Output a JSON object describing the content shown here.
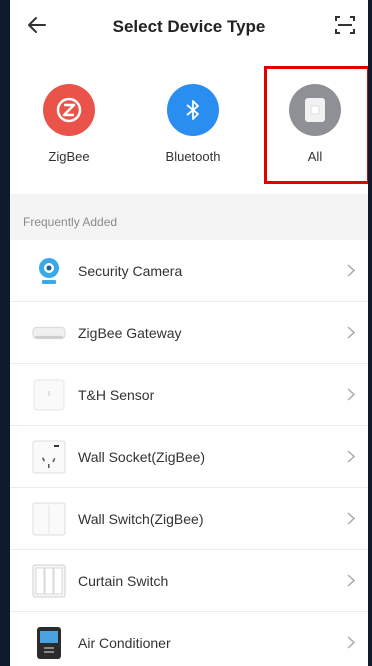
{
  "header": {
    "title": "Select Device Type",
    "back_icon": "arrow-left-icon",
    "scan_icon": "scan-icon"
  },
  "device_types": [
    {
      "label": "ZigBee",
      "icon": "zigbee-icon",
      "color": "#e9534a"
    },
    {
      "label": "Bluetooth",
      "icon": "bluetooth-icon",
      "color": "#2a8ef0"
    },
    {
      "label": "All",
      "icon": "all-devices-icon",
      "color": "#8f8f96"
    }
  ],
  "section_title": "Frequently Added",
  "devices": [
    {
      "label": "Security Camera",
      "icon": "security-camera-icon"
    },
    {
      "label": "ZigBee Gateway",
      "icon": "zigbee-gateway-icon"
    },
    {
      "label": "T&H Sensor",
      "icon": "th-sensor-icon"
    },
    {
      "label": "Wall Socket(ZigBee)",
      "icon": "wall-socket-icon"
    },
    {
      "label": "Wall Switch(ZigBee)",
      "icon": "wall-switch-icon"
    },
    {
      "label": "Curtain Switch",
      "icon": "curtain-switch-icon"
    },
    {
      "label": "Air Conditioner",
      "icon": "air-conditioner-icon"
    }
  ],
  "colors": {
    "highlight": "#e00000",
    "background": "#f4f4f4"
  }
}
